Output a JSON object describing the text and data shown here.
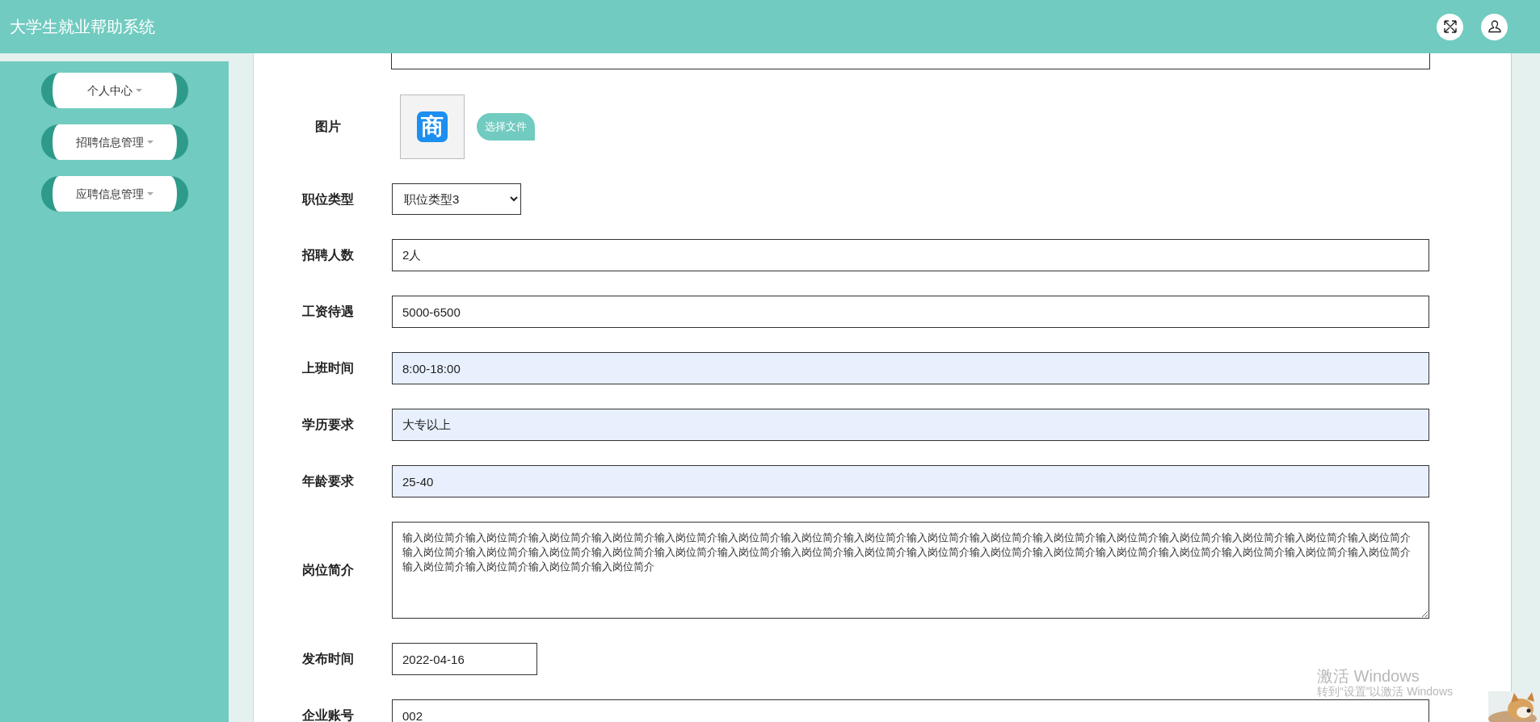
{
  "header": {
    "title": "大学生就业帮助系统"
  },
  "sidebar": {
    "items": [
      {
        "label": "个人中心"
      },
      {
        "label": "招聘信息管理"
      },
      {
        "label": "应聘信息管理"
      }
    ]
  },
  "form": {
    "rows": [
      {
        "label": "图片",
        "image_glyph": "商",
        "button": "选择文件"
      },
      {
        "kind": "select",
        "label": "职位类型",
        "value": "职位类型3"
      },
      {
        "kind": "text",
        "label": "招聘人数",
        "value": "2人",
        "autofilled": false
      },
      {
        "kind": "text",
        "label": "工资待遇",
        "value": "5000-6500",
        "autofilled": false
      },
      {
        "kind": "text",
        "label": "上班时间",
        "value": "8:00-18:00",
        "autofilled": true
      },
      {
        "kind": "text",
        "label": "学历要求",
        "value": "大专以上",
        "autofilled": true
      },
      {
        "kind": "text",
        "label": "年龄要求",
        "value": "25-40",
        "autofilled": true
      },
      {
        "kind": "textarea",
        "label": "岗位简介",
        "value": "输入岗位简介输入岗位简介输入岗位简介输入岗位简介输入岗位简介输入岗位简介输入岗位简介输入岗位简介输入岗位简介输入岗位简介输入岗位简介输入岗位简介输入岗位简介输入岗位简介输入岗位简介输入岗位简介输入岗位简介输入岗位简介输入岗位简介输入岗位简介输入岗位简介输入岗位简介输入岗位简介输入岗位简介输入岗位简介输入岗位简介输入岗位简介输入岗位简介输入岗位简介输入岗位简介输入岗位简介输入岗位简介输入岗位简介输入岗位简介输入岗位简介输入岗位简介"
      },
      {
        "kind": "date",
        "label": "发布时间",
        "value": "2022-04-16"
      },
      {
        "kind": "text",
        "label": "企业账号",
        "value": "002",
        "autofilled": false
      }
    ]
  },
  "activation_notice": {
    "title": "激活 Windows",
    "subtitle": "转到“设置”以激活 Windows"
  }
}
